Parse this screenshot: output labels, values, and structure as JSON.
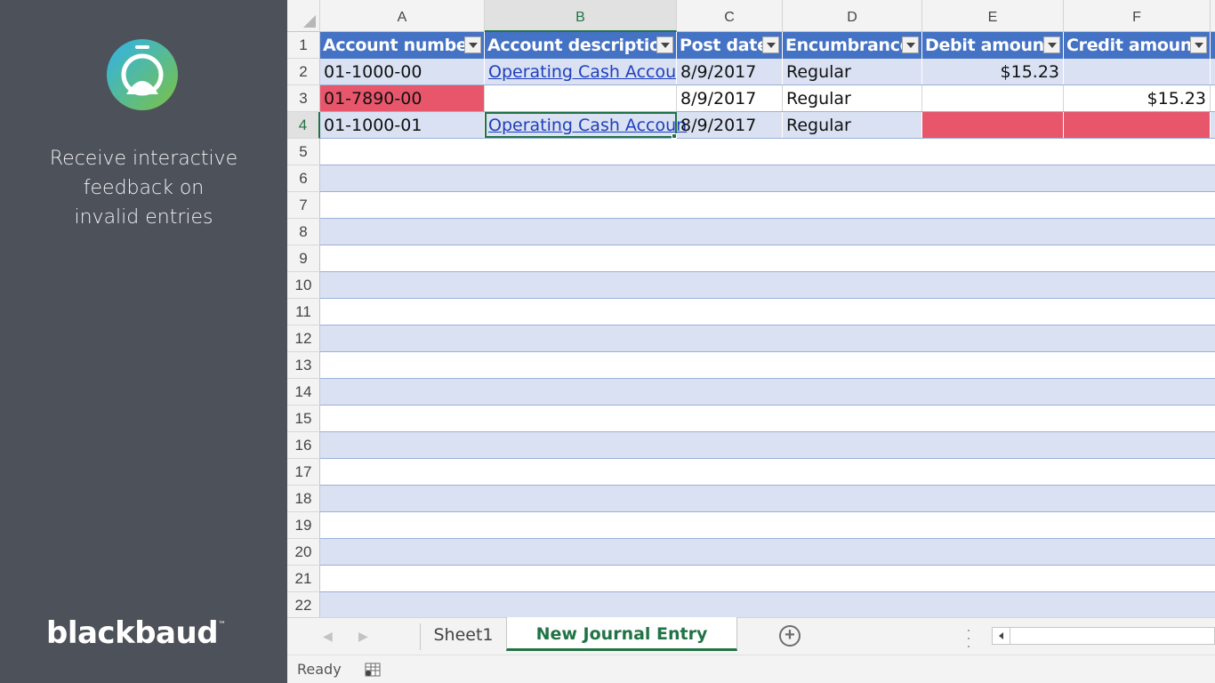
{
  "panel": {
    "tagline_lines": [
      "Receive interactive",
      "feedback on",
      "invalid entries"
    ],
    "brand": "blackbaud",
    "brand_tm": "™",
    "logo_icon": "app-logo-icon",
    "logo_colors": [
      "#34b5e5",
      "#7cc243"
    ]
  },
  "sheet": {
    "column_letters": [
      "A",
      "B",
      "C",
      "D",
      "E",
      "F"
    ],
    "selected_column": "B",
    "selected_row": "4",
    "row_numbers": [
      "1",
      "2",
      "3",
      "4",
      "5",
      "6",
      "7",
      "8",
      "9",
      "10",
      "11",
      "12",
      "13",
      "14",
      "15",
      "16",
      "17",
      "18",
      "19",
      "20",
      "21",
      "22"
    ],
    "headers": [
      "Account number",
      "Account description",
      "Post date",
      "Encumbrance",
      "Debit amount",
      "Credit amount"
    ],
    "rows": [
      [
        "01-1000-00",
        "Operating Cash Accoun",
        "8/9/2017",
        "Regular",
        "$15.23",
        ""
      ],
      [
        "01-7890-00",
        "",
        "8/9/2017",
        "Regular",
        "",
        "$15.23"
      ],
      [
        "01-1000-01",
        "Operating Cash Accoun",
        "8/9/2017",
        "Regular",
        "",
        ""
      ]
    ],
    "colors": {
      "header_blue": "#4472c4",
      "band_blue": "#d9e1f2",
      "error_red": "#e8566b",
      "excel_green": "#217346"
    }
  },
  "tabs": {
    "sheets": [
      "Sheet1",
      "New Journal Entry Batch"
    ],
    "active": "New Journal Entry Batch",
    "add_icon": "add-sheet-icon"
  },
  "status": {
    "text": "Ready",
    "icon": "macro-record-icon"
  }
}
